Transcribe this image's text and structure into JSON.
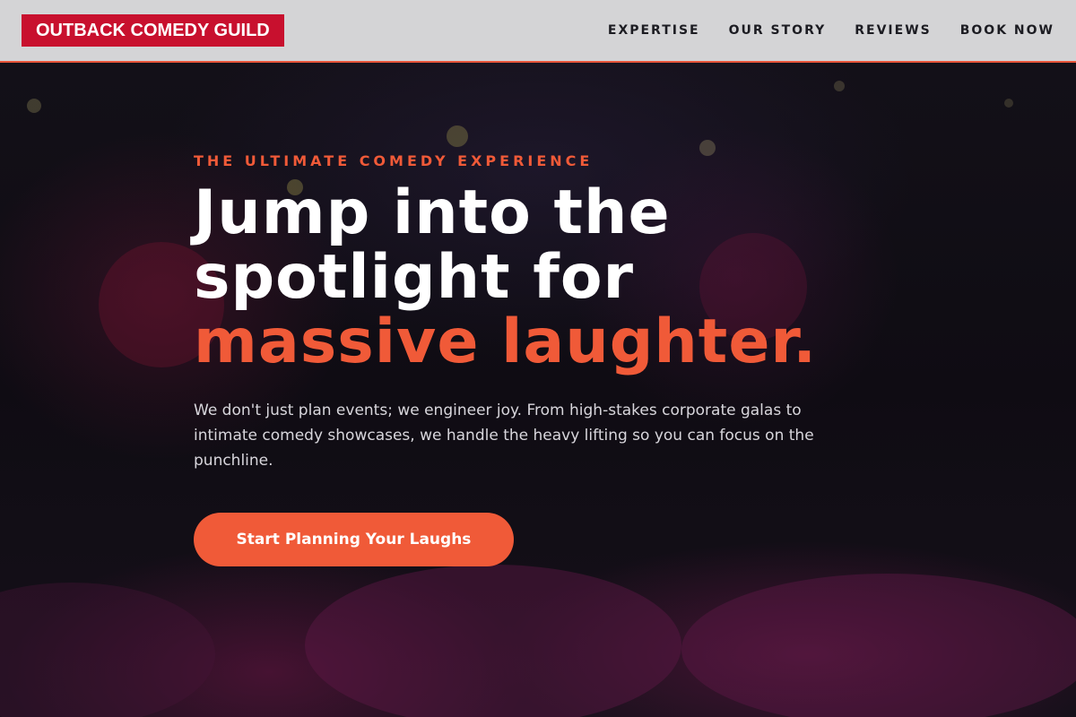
{
  "brand": {
    "logo_text": "OUTBACK COMEDY GUILD",
    "logo_bg": "#c8102e"
  },
  "nav": {
    "items": [
      {
        "label": "EXPERTISE"
      },
      {
        "label": "OUR STORY"
      },
      {
        "label": "REVIEWS"
      },
      {
        "label": "BOOK NOW"
      }
    ]
  },
  "hero": {
    "eyebrow": "THE ULTIMATE COMEDY EXPERIENCE",
    "headline_line1": "Jump into the",
    "headline_line2": "spotlight for",
    "headline_accent": "massive laughter.",
    "description": "We don't just plan events; we engineer joy. From high-stakes corporate galas to intimate comedy showcases, we handle the heavy lifting so you can focus on the punchline.",
    "cta_label": "Start Planning Your Laughs"
  },
  "colors": {
    "accent": "#f05a38",
    "header_bg": "#d4d4d6",
    "hero_bg": "#0f0c13"
  }
}
